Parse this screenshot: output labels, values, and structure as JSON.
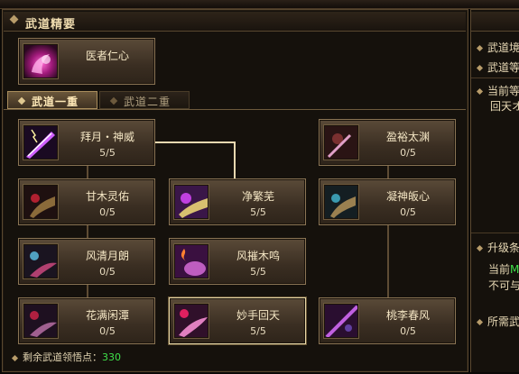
{
  "panel": {
    "title": "武道精要"
  },
  "top_skill": {
    "name": "医者仁心"
  },
  "tabs": [
    {
      "label": "武道一重"
    },
    {
      "label": "武道二重"
    }
  ],
  "skills": {
    "baiyue": {
      "name": "拜月・神威",
      "level": "5/5"
    },
    "yingyu": {
      "name": "盈裕太渊",
      "level": "0/5"
    },
    "ganmu": {
      "name": "甘木灵佑",
      "level": "0/5"
    },
    "jingfen": {
      "name": "净繁芜",
      "level": "5/5"
    },
    "ningshen": {
      "name": "凝神皈心",
      "level": "0/5"
    },
    "fengqing": {
      "name": "风清月朗",
      "level": "0/5"
    },
    "fengcui": {
      "name": "风摧木鸣",
      "level": "5/5"
    },
    "huaman": {
      "name": "花满闲潭",
      "level": "0/5"
    },
    "miaoshou": {
      "name": "妙手回天",
      "level": "5/5"
    },
    "taoli": {
      "name": "桃李春风",
      "level": "0/5"
    }
  },
  "footer": {
    "label": "剩余武道领悟点：",
    "value": "330"
  },
  "right_panel": {
    "line1": "武道境",
    "line2": "武道等",
    "line3": "当前等",
    "line4": "回天オ",
    "line5": "升级条",
    "line6_prefix": "当前",
    "line6_green": "M",
    "line7": "不可与",
    "line8": "所需武"
  },
  "colors": {
    "accent_gold": "#e8d8a8",
    "points_green": "#3fe04a"
  }
}
